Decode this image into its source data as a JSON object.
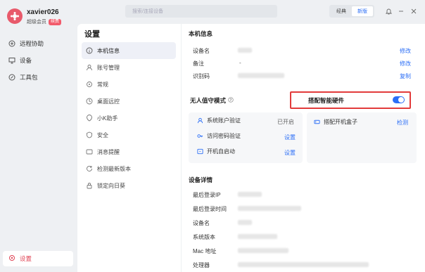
{
  "profile": {
    "username": "xavier026",
    "role": "超级会员",
    "badge": "续费"
  },
  "app_nav": [
    {
      "label": "远程协助",
      "icon": "remote-assist-icon"
    },
    {
      "label": "设备",
      "icon": "monitor-icon"
    },
    {
      "label": "工具包",
      "icon": "toolbox-icon"
    }
  ],
  "app_nav_bottom": {
    "label": "设置",
    "icon": "gear-icon"
  },
  "topbar": {
    "search_placeholder": "搜索/连接设备",
    "modes": [
      "经典",
      "新版"
    ],
    "active_mode": "新版"
  },
  "settings": {
    "title": "设置",
    "items": [
      {
        "label": "本机信息",
        "icon": "info-icon",
        "active": true
      },
      {
        "label": "账号管理",
        "icon": "user-icon"
      },
      {
        "label": "常规",
        "icon": "general-icon"
      },
      {
        "label": "桌面远控",
        "icon": "desktop-icon"
      },
      {
        "label": "小K助手",
        "icon": "assistant-icon"
      },
      {
        "label": "安全",
        "icon": "shield-icon"
      },
      {
        "label": "消息提醒",
        "icon": "message-icon"
      },
      {
        "label": "检测最新版本",
        "icon": "update-icon"
      },
      {
        "label": "锁定向日葵",
        "icon": "lock-icon"
      }
    ]
  },
  "machine_info": {
    "title": "本机信息",
    "rows": [
      {
        "label": "设备名",
        "action": "修改"
      },
      {
        "label": "备注",
        "value": "-",
        "action": "修改"
      },
      {
        "label": "识别码",
        "action": "复制"
      }
    ]
  },
  "unattended": {
    "title": "无人值守模式",
    "toggle_on": true,
    "items": [
      {
        "label": "系统账户验证",
        "status": "已开启",
        "icon": "user-icon"
      },
      {
        "label": "访问密码验证",
        "action": "设置",
        "icon": "key-icon"
      },
      {
        "label": "开机自启动",
        "action": "设置",
        "icon": "power-icon"
      }
    ]
  },
  "smart_hardware": {
    "title": "搭配智能硬件",
    "items": [
      {
        "label": "搭配开机盒子",
        "action": "检测",
        "icon": "box-icon"
      }
    ]
  },
  "device_details": {
    "title": "设备详情",
    "rows": [
      {
        "label": "最后登录IP"
      },
      {
        "label": "最后登录时间"
      },
      {
        "label": "设备名"
      },
      {
        "label": "系统版本"
      },
      {
        "label": "Mac 地址"
      },
      {
        "label": "处理器"
      }
    ]
  },
  "colors": {
    "accent": "#2b6ef6",
    "brand": "#e85a6b",
    "highlight": "#e23b3b"
  }
}
